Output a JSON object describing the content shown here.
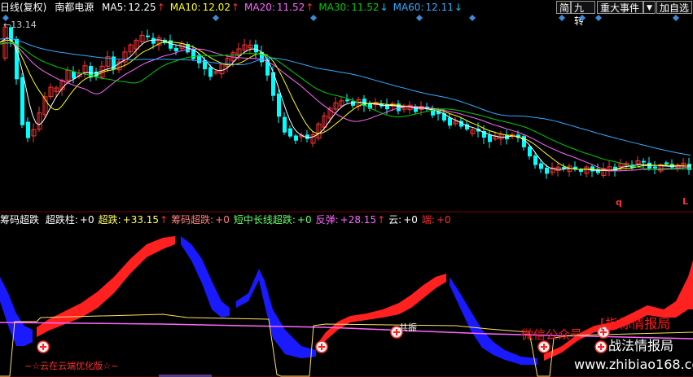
{
  "header": {
    "period": "日线(复权)",
    "stock": "南都电源",
    "ma": [
      {
        "label": "MA5:",
        "value": "12.25",
        "arrow": "↑",
        "color": "#ffffff",
        "acolor": "#ff3030"
      },
      {
        "label": "MA10:",
        "value": "12.02",
        "arrow": "↑",
        "color": "#ffff00",
        "acolor": "#ff3030"
      },
      {
        "label": "MA20:",
        "value": "11.52",
        "arrow": "↑",
        "color": "#ff66ff",
        "acolor": "#ff3030"
      },
      {
        "label": "MA30:",
        "value": "11.52",
        "arrow": "↓",
        "color": "#00cc00",
        "acolor": "#00ccff"
      },
      {
        "label": "MA60:",
        "value": "12.11",
        "arrow": "↓",
        "color": "#33aaff",
        "acolor": "#00ccff"
      }
    ]
  },
  "toolbar": {
    "simple": "简",
    "nine": "九转",
    "events": "重大事件",
    "dropdown": "▼",
    "add": "加自选"
  },
  "price_chart": {
    "high_label": "13.14",
    "markers": [
      "q",
      "L"
    ]
  },
  "indicator": {
    "name": "筹码超跌",
    "items": [
      {
        "label": "超跌柱:",
        "value": "+0",
        "arrow": "",
        "color": "#ffffff"
      },
      {
        "label": "超跌:",
        "value": "+33.15",
        "arrow": "↑",
        "color": "#ffff66"
      },
      {
        "label": "筹码超跌:",
        "value": "+0",
        "arrow": "",
        "color": "#ff8080"
      },
      {
        "label": "短中长线超跌:",
        "value": "+0",
        "arrow": "",
        "color": "#66ff66"
      },
      {
        "label": "反弹:",
        "value": "+28.15",
        "arrow": "↑",
        "color": "#ff66ff"
      },
      {
        "label": "云:",
        "value": "+0",
        "arrow": "",
        "color": "#ffffff"
      },
      {
        "label": "端:",
        "value": "+0",
        "arrow": "",
        "color": "#ff3030"
      }
    ],
    "signal": "共振",
    "watermark_left": "~☆云在云端优化版☆~",
    "watermark_mid": "微信公众号",
    "watermark_right1": "[指标情报局",
    "watermark_right2": "战法情报局",
    "watermark_url": "www.zhibiao168.com"
  },
  "colors": {
    "up": "#ff3333",
    "down": "#00ffff",
    "ma5": "#ffffff",
    "ma10": "#ffff00",
    "ma20": "#ff66ff",
    "ma30": "#00cc00",
    "ma60": "#33aaff"
  }
}
